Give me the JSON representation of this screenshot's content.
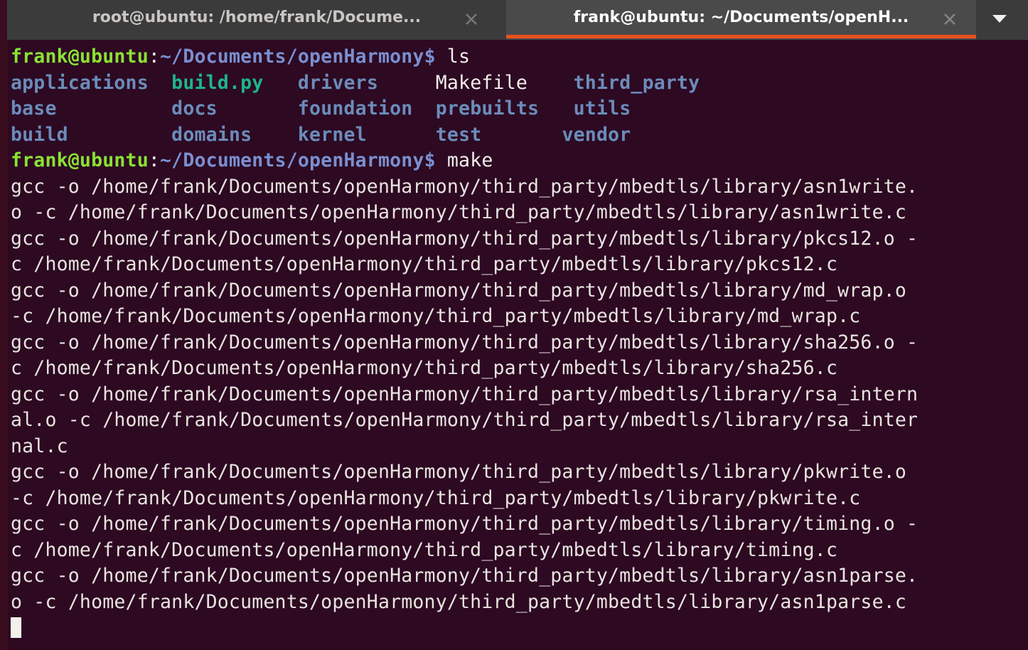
{
  "window": {
    "title": "frank@ubuntu: ~/Documents/openHarmony",
    "background_color": "#2d0922",
    "tabbar_color": "#3b3b3b",
    "active_tab_color": "#4a4a4a",
    "accent_color": "#e8501c"
  },
  "tabbar": {
    "tabs": [
      {
        "label": "root@ubuntu: /home/frank/Docume...",
        "active": false,
        "close_icon": "close-icon"
      },
      {
        "label": "frank@ubuntu: ~/Documents/openH...",
        "active": true,
        "close_icon": "close-icon"
      }
    ],
    "menu_icon": "chevron-down-icon"
  },
  "terminal": {
    "prompt": {
      "user_host": "frank@ubuntu",
      "colon": ":",
      "path": "~/Documents/openHarmony",
      "sigil": "$"
    },
    "commands": {
      "first": "ls",
      "second": "make"
    },
    "ls_output": {
      "columns": [
        [
          "applications",
          "base",
          "build"
        ],
        [
          "build.py",
          "docs",
          "domains"
        ],
        [
          "drivers",
          "foundation",
          "kernel"
        ],
        [
          "Makefile",
          "prebuilts",
          "test"
        ],
        [
          "third_party",
          "utils",
          "vendor"
        ]
      ],
      "rows": [
        [
          {
            "name": "applications",
            "kind": "dir"
          },
          {
            "name": "build.py",
            "kind": "exec"
          },
          {
            "name": "drivers",
            "kind": "dir"
          },
          {
            "name": "Makefile",
            "kind": "file"
          },
          {
            "name": "third_party",
            "kind": "dir"
          }
        ],
        [
          {
            "name": "base",
            "kind": "dir"
          },
          {
            "name": "docs",
            "kind": "dir"
          },
          {
            "name": "foundation",
            "kind": "dir"
          },
          {
            "name": "prebuilts",
            "kind": "dir"
          },
          {
            "name": "utils",
            "kind": "dir"
          }
        ],
        [
          {
            "name": "build",
            "kind": "dir"
          },
          {
            "name": "domains",
            "kind": "dir"
          },
          {
            "name": "kernel",
            "kind": "dir"
          },
          {
            "name": "test",
            "kind": "dir"
          },
          {
            "name": "vendor",
            "kind": "dir"
          }
        ]
      ],
      "line1": "applications  build.py   drivers     Makefile    third_party",
      "line2": "base          docs       foundation  prebuilts   utils",
      "line3": "build         domains    kernel      test        vendor"
    },
    "make_output_lines": [
      "gcc -o /home/frank/Documents/openHarmony/third_party/mbedtls/library/asn1write.",
      "o -c /home/frank/Documents/openHarmony/third_party/mbedtls/library/asn1write.c",
      "gcc -o /home/frank/Documents/openHarmony/third_party/mbedtls/library/pkcs12.o -",
      "c /home/frank/Documents/openHarmony/third_party/mbedtls/library/pkcs12.c",
      "gcc -o /home/frank/Documents/openHarmony/third_party/mbedtls/library/md_wrap.o",
      "-c /home/frank/Documents/openHarmony/third_party/mbedtls/library/md_wrap.c",
      "gcc -o /home/frank/Documents/openHarmony/third_party/mbedtls/library/sha256.o -",
      "c /home/frank/Documents/openHarmony/third_party/mbedtls/library/sha256.c",
      "gcc -o /home/frank/Documents/openHarmony/third_party/mbedtls/library/rsa_intern",
      "al.o -c /home/frank/Documents/openHarmony/third_party/mbedtls/library/rsa_inter",
      "nal.c",
      "gcc -o /home/frank/Documents/openHarmony/third_party/mbedtls/library/pkwrite.o",
      "-c /home/frank/Documents/openHarmony/third_party/mbedtls/library/pkwrite.c",
      "gcc -o /home/frank/Documents/openHarmony/third_party/mbedtls/library/timing.o -",
      "c /home/frank/Documents/openHarmony/third_party/mbedtls/library/timing.c",
      "gcc -o /home/frank/Documents/openHarmony/third_party/mbedtls/library/asn1parse.",
      "o -c /home/frank/Documents/openHarmony/third_party/mbedtls/library/asn1parse.c"
    ],
    "cursor": {
      "visible": true,
      "style": "block",
      "color": "#f4f1ec"
    }
  }
}
